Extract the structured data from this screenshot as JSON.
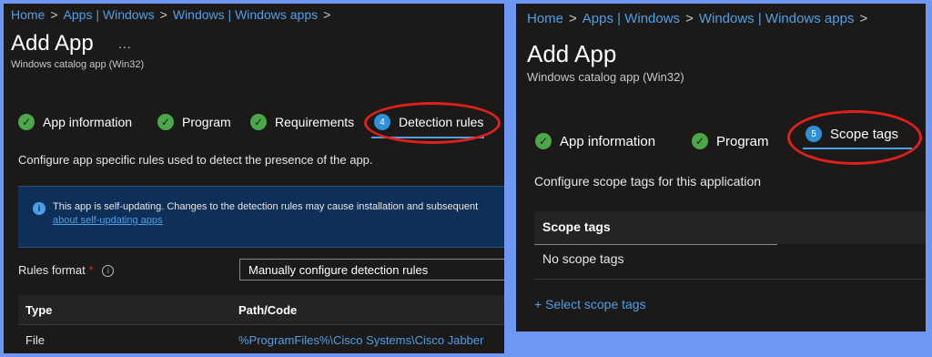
{
  "left": {
    "breadcrumb": [
      "Home",
      "Apps | Windows",
      "Windows | Windows apps"
    ],
    "title": "Add App",
    "more": "...",
    "subtitle": "Windows catalog app (Win32)",
    "tabs": [
      {
        "label": "App information",
        "state": "complete"
      },
      {
        "label": "Program",
        "state": "complete"
      },
      {
        "label": "Requirements",
        "state": "complete"
      },
      {
        "label": "Detection rules",
        "state": "active",
        "step": "4"
      }
    ],
    "description": "Configure app specific rules used to detect the presence of the app.",
    "banner": {
      "text": "This app is self-updating. Changes to the detection rules may cause installation and subsequent",
      "link": "about self-updating apps"
    },
    "rules_format": {
      "label": "Rules format",
      "required": "*",
      "value": "Manually configure detection rules"
    },
    "table": {
      "headers": [
        "Type",
        "Path/Code"
      ],
      "rows": [
        {
          "type": "File",
          "path": "%ProgramFiles%\\Cisco Systems\\Cisco Jabber"
        }
      ]
    }
  },
  "right": {
    "breadcrumb": [
      "Home",
      "Apps | Windows",
      "Windows | Windows apps"
    ],
    "title": "Add App",
    "subtitle": "Windows catalog app (Win32)",
    "tabs": [
      {
        "label": "App information",
        "state": "complete"
      },
      {
        "label": "Program",
        "state": "complete"
      },
      {
        "label": "Scope tags",
        "state": "active",
        "step": "5"
      }
    ],
    "description": "Configure scope tags for this application",
    "table": {
      "header": "Scope tags",
      "empty": "No scope tags"
    },
    "select_link": "+ Select scope tags"
  },
  "colors": {
    "background": "#6d97f2",
    "panel": "#1b1a19",
    "accent": "#4f9fe6",
    "complete": "#4aa84a",
    "annotation": "#e0201b"
  },
  "icons": [
    "chevron-right-icon",
    "more-icon",
    "check-circle-icon",
    "info-icon",
    "tooltip-icon",
    "chevron-down-icon"
  ]
}
